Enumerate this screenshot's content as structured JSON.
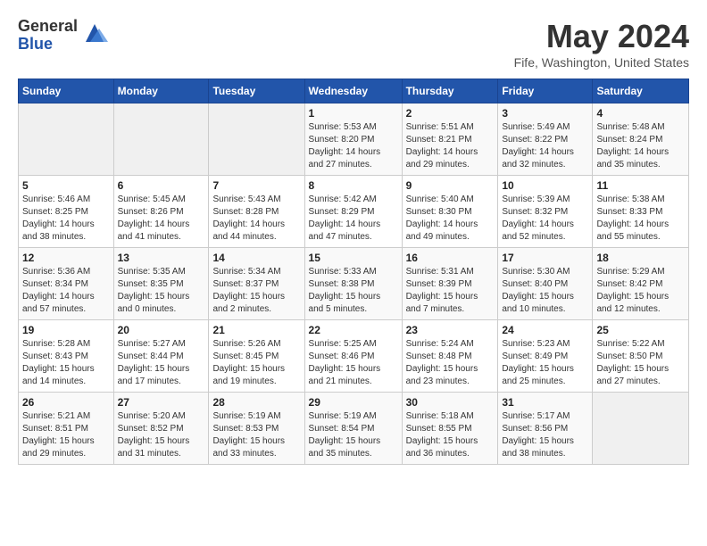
{
  "header": {
    "logo_general": "General",
    "logo_blue": "Blue",
    "month_title": "May 2024",
    "location": "Fife, Washington, United States"
  },
  "days_of_week": [
    "Sunday",
    "Monday",
    "Tuesday",
    "Wednesday",
    "Thursday",
    "Friday",
    "Saturday"
  ],
  "weeks": [
    [
      {
        "day": "",
        "info": ""
      },
      {
        "day": "",
        "info": ""
      },
      {
        "day": "",
        "info": ""
      },
      {
        "day": "1",
        "info": "Sunrise: 5:53 AM\nSunset: 8:20 PM\nDaylight: 14 hours\nand 27 minutes."
      },
      {
        "day": "2",
        "info": "Sunrise: 5:51 AM\nSunset: 8:21 PM\nDaylight: 14 hours\nand 29 minutes."
      },
      {
        "day": "3",
        "info": "Sunrise: 5:49 AM\nSunset: 8:22 PM\nDaylight: 14 hours\nand 32 minutes."
      },
      {
        "day": "4",
        "info": "Sunrise: 5:48 AM\nSunset: 8:24 PM\nDaylight: 14 hours\nand 35 minutes."
      }
    ],
    [
      {
        "day": "5",
        "info": "Sunrise: 5:46 AM\nSunset: 8:25 PM\nDaylight: 14 hours\nand 38 minutes."
      },
      {
        "day": "6",
        "info": "Sunrise: 5:45 AM\nSunset: 8:26 PM\nDaylight: 14 hours\nand 41 minutes."
      },
      {
        "day": "7",
        "info": "Sunrise: 5:43 AM\nSunset: 8:28 PM\nDaylight: 14 hours\nand 44 minutes."
      },
      {
        "day": "8",
        "info": "Sunrise: 5:42 AM\nSunset: 8:29 PM\nDaylight: 14 hours\nand 47 minutes."
      },
      {
        "day": "9",
        "info": "Sunrise: 5:40 AM\nSunset: 8:30 PM\nDaylight: 14 hours\nand 49 minutes."
      },
      {
        "day": "10",
        "info": "Sunrise: 5:39 AM\nSunset: 8:32 PM\nDaylight: 14 hours\nand 52 minutes."
      },
      {
        "day": "11",
        "info": "Sunrise: 5:38 AM\nSunset: 8:33 PM\nDaylight: 14 hours\nand 55 minutes."
      }
    ],
    [
      {
        "day": "12",
        "info": "Sunrise: 5:36 AM\nSunset: 8:34 PM\nDaylight: 14 hours\nand 57 minutes."
      },
      {
        "day": "13",
        "info": "Sunrise: 5:35 AM\nSunset: 8:35 PM\nDaylight: 15 hours\nand 0 minutes."
      },
      {
        "day": "14",
        "info": "Sunrise: 5:34 AM\nSunset: 8:37 PM\nDaylight: 15 hours\nand 2 minutes."
      },
      {
        "day": "15",
        "info": "Sunrise: 5:33 AM\nSunset: 8:38 PM\nDaylight: 15 hours\nand 5 minutes."
      },
      {
        "day": "16",
        "info": "Sunrise: 5:31 AM\nSunset: 8:39 PM\nDaylight: 15 hours\nand 7 minutes."
      },
      {
        "day": "17",
        "info": "Sunrise: 5:30 AM\nSunset: 8:40 PM\nDaylight: 15 hours\nand 10 minutes."
      },
      {
        "day": "18",
        "info": "Sunrise: 5:29 AM\nSunset: 8:42 PM\nDaylight: 15 hours\nand 12 minutes."
      }
    ],
    [
      {
        "day": "19",
        "info": "Sunrise: 5:28 AM\nSunset: 8:43 PM\nDaylight: 15 hours\nand 14 minutes."
      },
      {
        "day": "20",
        "info": "Sunrise: 5:27 AM\nSunset: 8:44 PM\nDaylight: 15 hours\nand 17 minutes."
      },
      {
        "day": "21",
        "info": "Sunrise: 5:26 AM\nSunset: 8:45 PM\nDaylight: 15 hours\nand 19 minutes."
      },
      {
        "day": "22",
        "info": "Sunrise: 5:25 AM\nSunset: 8:46 PM\nDaylight: 15 hours\nand 21 minutes."
      },
      {
        "day": "23",
        "info": "Sunrise: 5:24 AM\nSunset: 8:48 PM\nDaylight: 15 hours\nand 23 minutes."
      },
      {
        "day": "24",
        "info": "Sunrise: 5:23 AM\nSunset: 8:49 PM\nDaylight: 15 hours\nand 25 minutes."
      },
      {
        "day": "25",
        "info": "Sunrise: 5:22 AM\nSunset: 8:50 PM\nDaylight: 15 hours\nand 27 minutes."
      }
    ],
    [
      {
        "day": "26",
        "info": "Sunrise: 5:21 AM\nSunset: 8:51 PM\nDaylight: 15 hours\nand 29 minutes."
      },
      {
        "day": "27",
        "info": "Sunrise: 5:20 AM\nSunset: 8:52 PM\nDaylight: 15 hours\nand 31 minutes."
      },
      {
        "day": "28",
        "info": "Sunrise: 5:19 AM\nSunset: 8:53 PM\nDaylight: 15 hours\nand 33 minutes."
      },
      {
        "day": "29",
        "info": "Sunrise: 5:19 AM\nSunset: 8:54 PM\nDaylight: 15 hours\nand 35 minutes."
      },
      {
        "day": "30",
        "info": "Sunrise: 5:18 AM\nSunset: 8:55 PM\nDaylight: 15 hours\nand 36 minutes."
      },
      {
        "day": "31",
        "info": "Sunrise: 5:17 AM\nSunset: 8:56 PM\nDaylight: 15 hours\nand 38 minutes."
      },
      {
        "day": "",
        "info": ""
      }
    ]
  ]
}
